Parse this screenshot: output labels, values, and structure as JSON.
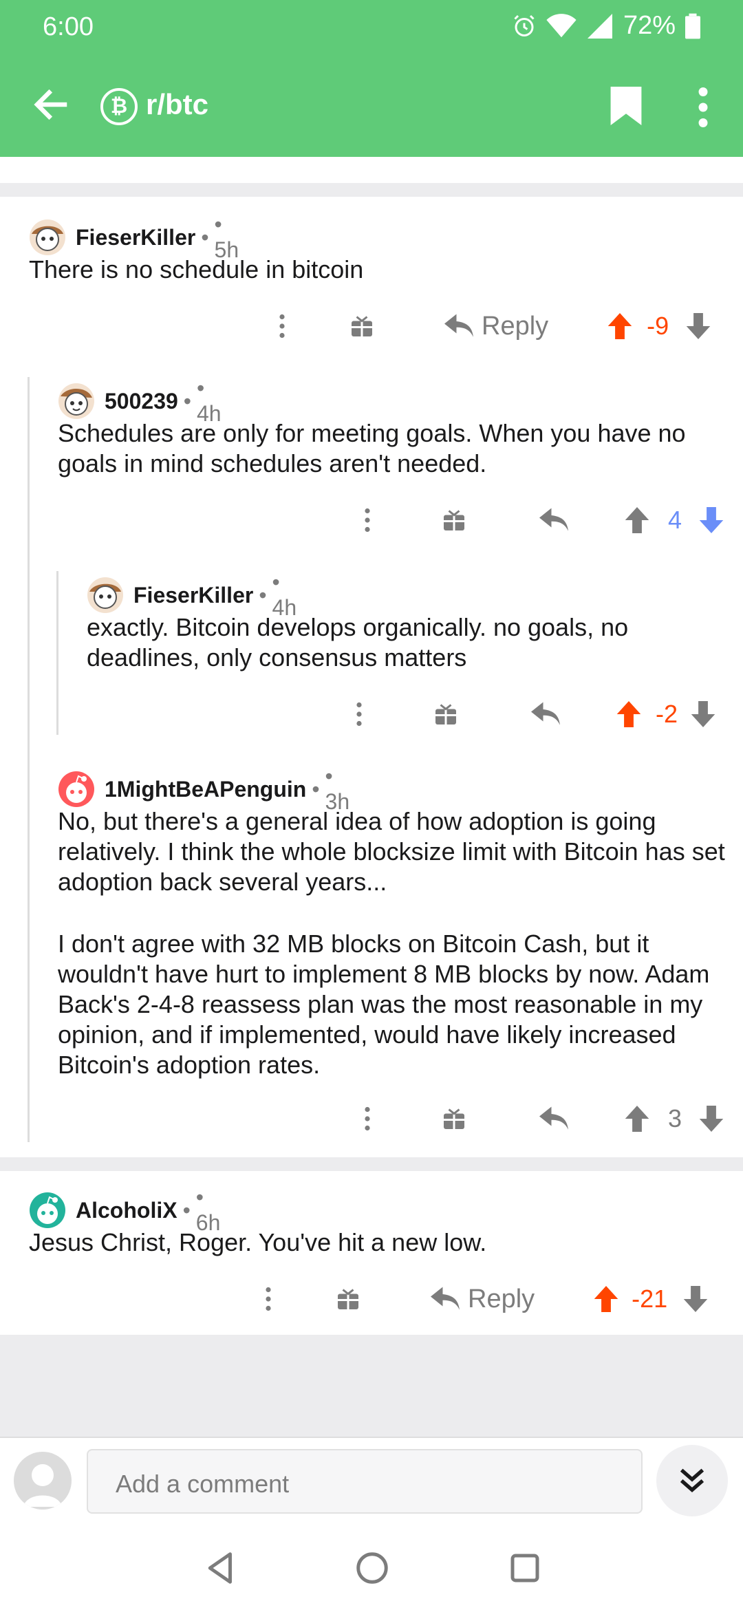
{
  "status_bar": {
    "time": "6:00",
    "battery": "72%"
  },
  "toolbar": {
    "subreddit": "r/btc",
    "icons": [
      "back-arrow-icon",
      "bitcoin-icon",
      "bookmark-icon",
      "more-vert-icon"
    ]
  },
  "colors": {
    "header": "#5fcb78",
    "upvote": "#ff4500",
    "downvote": "#6a8ef8",
    "neutral": "#7c7c7c"
  },
  "comments": [
    {
      "author": "FieserKiller",
      "dot": "•",
      "time": "• 5h",
      "body": "There is no schedule in bitcoin",
      "reply_label": "Reply",
      "score": "-9",
      "vote": "up"
    },
    {
      "author": "500239",
      "dot": "•",
      "time": "• 4h",
      "body": "Schedules are only for meeting goals. When you have no goals in mind schedules aren't needed.",
      "score": "4",
      "vote": "down"
    },
    {
      "author": "FieserKiller",
      "dot": "•",
      "time": "• 4h",
      "body": "exactly. Bitcoin develops organically. no goals, no deadlines, only consensus matters",
      "score": "-2",
      "vote": "up"
    },
    {
      "author": "1MightBeAPenguin",
      "dot": "•",
      "time": "• 3h",
      "body_p1": "No, but there's a general idea of how adoption is going relatively. I think the whole blocksize limit with Bitcoin has set adoption back several years...",
      "body_p2": "I don't agree with 32 MB blocks on Bitcoin Cash, but it wouldn't have hurt to implement 8 MB blocks by now. Adam Back's 2-4-8 reassess plan was the most reasonable in my opinion, and if implemented, would have likely increased Bitcoin's adoption rates.",
      "score": "3",
      "vote": "none"
    },
    {
      "author": "AlcoholiX",
      "dot": "•",
      "time": "• 6h",
      "body": "Jesus Christ, Roger. You've hit a new low.",
      "reply_label": "Reply",
      "score": "-21",
      "vote": "up"
    }
  ],
  "composer": {
    "placeholder": "Add a comment"
  }
}
